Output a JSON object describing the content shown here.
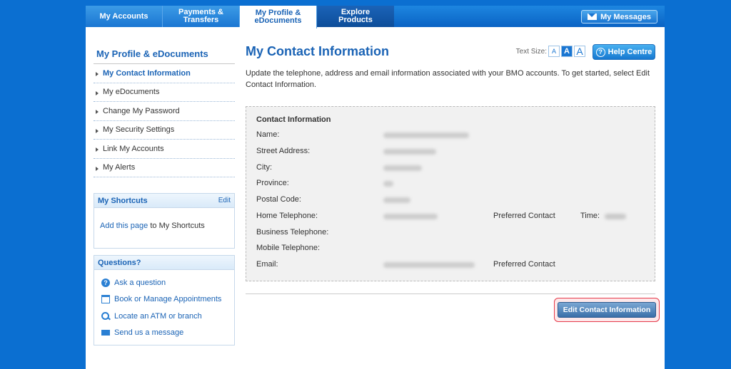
{
  "tabs": [
    {
      "line1": "My Accounts",
      "line2": ""
    },
    {
      "line1": "Payments &",
      "line2": "Transfers"
    },
    {
      "line1": "My Profile &",
      "line2": "eDocuments"
    },
    {
      "line1": "Explore",
      "line2": "Products"
    }
  ],
  "messages_label": "My Messages",
  "sidebar": {
    "title": "My Profile & eDocuments",
    "items": [
      {
        "label": "My Contact Information"
      },
      {
        "label": "My eDocuments"
      },
      {
        "label": "Change My Password"
      },
      {
        "label": "My Security Settings"
      },
      {
        "label": "Link My Accounts"
      },
      {
        "label": "My Alerts"
      }
    ]
  },
  "shortcuts": {
    "title": "My Shortcuts",
    "edit_label": "Edit",
    "add_link": "Add this page",
    "add_rest": " to My Shortcuts"
  },
  "questions": {
    "title": "Questions?",
    "items": [
      {
        "label": "Ask a question",
        "icon": "help-icon"
      },
      {
        "label": "Book or Manage Appointments",
        "icon": "calendar-icon"
      },
      {
        "label": "Locate an ATM or branch",
        "icon": "magnifier-icon"
      },
      {
        "label": "Send us a message",
        "icon": "mail-icon"
      }
    ]
  },
  "main": {
    "title": "My Contact Information",
    "text_size_label": "Text Size:",
    "text_size_options": [
      "A",
      "A",
      "A"
    ],
    "help_label": "Help Centre",
    "intro": "Update the telephone, address and email information associated with your BMO accounts. To get started, select Edit Contact Information."
  },
  "contact": {
    "heading": "Contact Information",
    "labels": {
      "name": "Name:",
      "street": "Street Address:",
      "city": "City:",
      "province": "Province:",
      "postal": "Postal Code:",
      "home": "Home Telephone:",
      "business": "Business Telephone:",
      "mobile": "Mobile Telephone:",
      "email": "Email:"
    },
    "preferred_label": "Preferred Contact",
    "time_label": "Time:"
  },
  "edit_button_label": "Edit Contact Information",
  "colors": {
    "background": "#0b6fd1",
    "brand_blue": "#1a63b5",
    "highlight_red": "#e63a4a"
  }
}
